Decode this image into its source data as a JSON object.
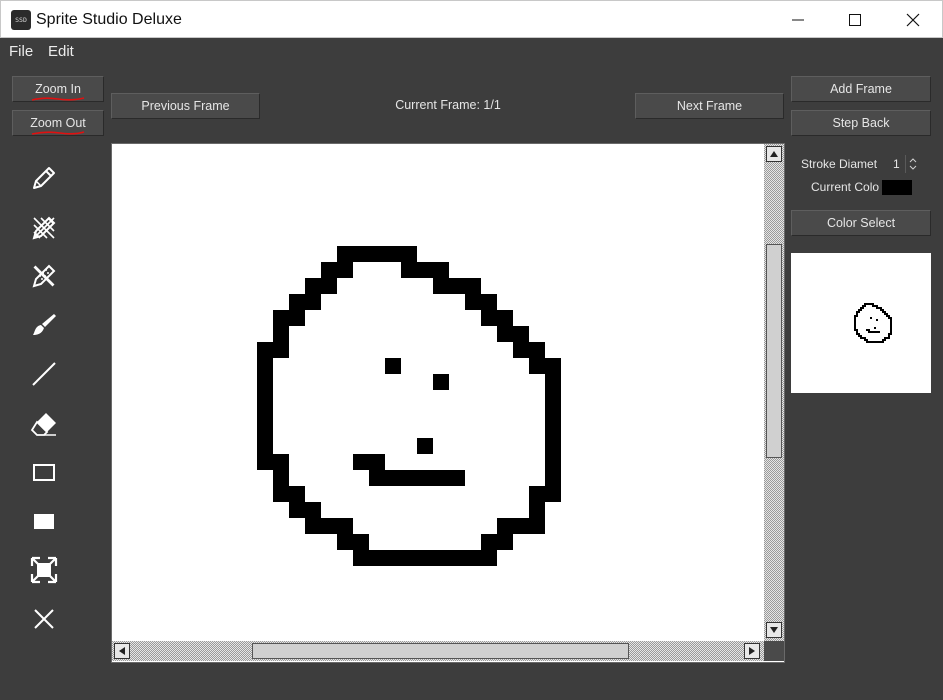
{
  "window": {
    "title": "Sprite Studio Deluxe",
    "icon_label": "SSD"
  },
  "menu": [
    {
      "label": "File"
    },
    {
      "label": "Edit"
    }
  ],
  "zoom": {
    "zoom_in": "Zoom In",
    "zoom_out": "Zoom Out"
  },
  "frames": {
    "previous": "Previous Frame",
    "next": "Next Frame",
    "current": "Current Frame: 1/1",
    "add": "Add Frame",
    "step_back": "Step Back"
  },
  "tools": [
    {
      "name": "pencil-icon"
    },
    {
      "name": "dither-pencil-icon"
    },
    {
      "name": "shade-pencil-icon"
    },
    {
      "name": "brush-icon"
    },
    {
      "name": "line-icon"
    },
    {
      "name": "eraser-icon"
    },
    {
      "name": "rectangle-outline-icon"
    },
    {
      "name": "filled-rectangle-icon"
    },
    {
      "name": "select-expand-icon"
    },
    {
      "name": "clear-icon"
    }
  ],
  "properties": {
    "stroke_label": "Stroke Diamet",
    "stroke_value": "1",
    "color_label": "Current Colo",
    "current_color": "#000000",
    "color_select": "Color Select"
  },
  "colors": {
    "background": "#3d3d3d",
    "button": "#4a4a4a",
    "text": "#e6e6e6",
    "underline": "#e01010"
  }
}
